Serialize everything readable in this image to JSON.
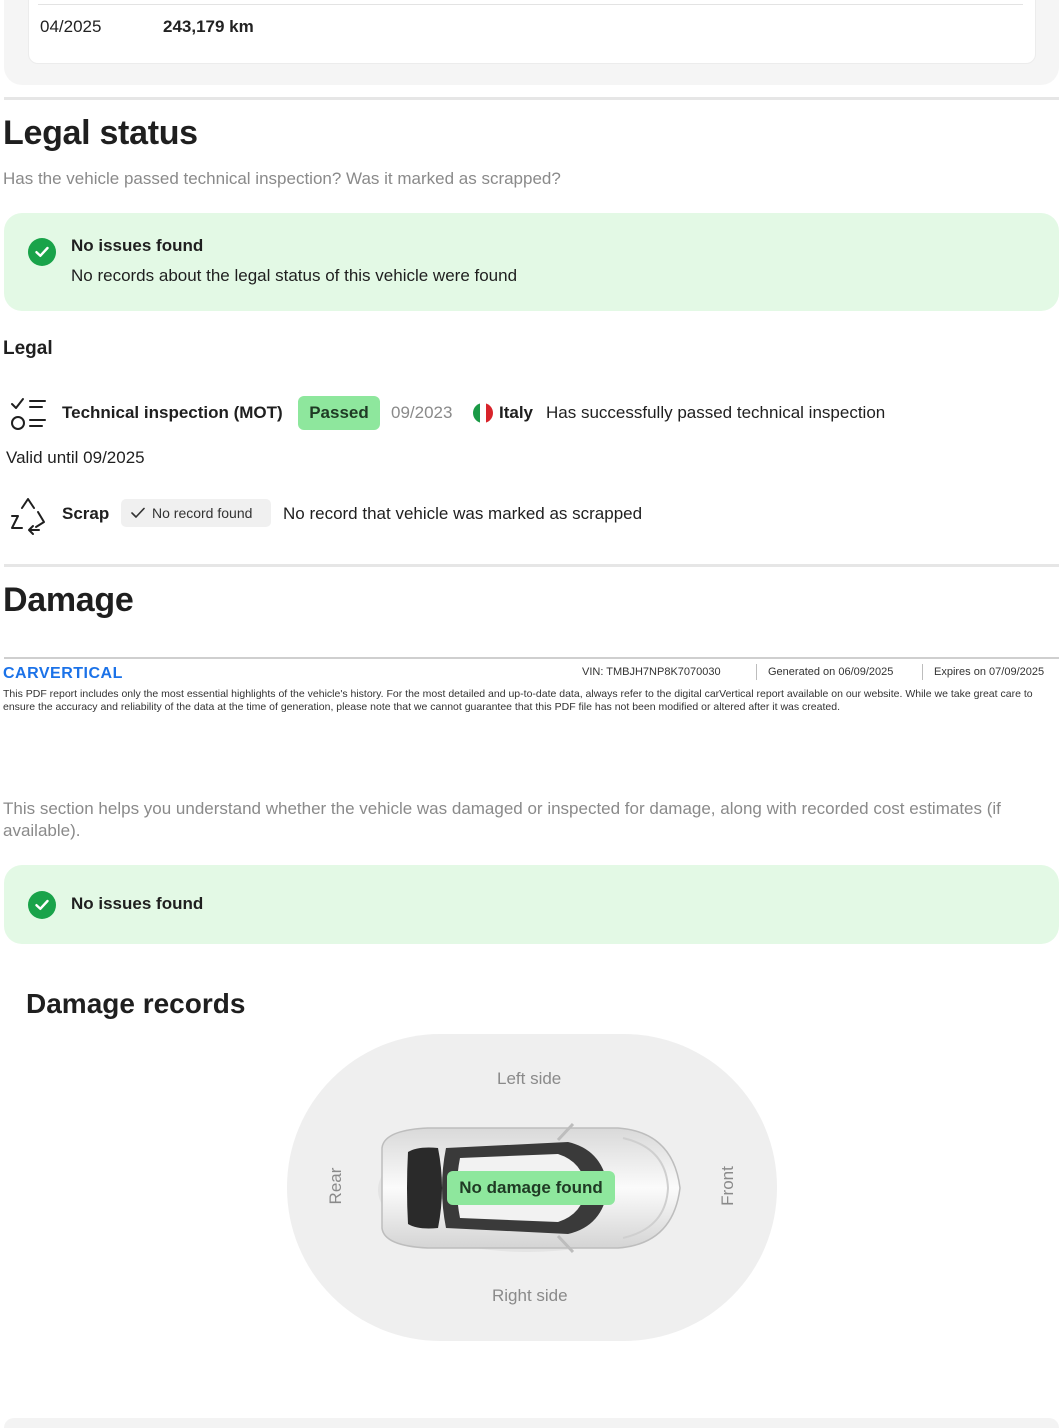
{
  "mileage_row": {
    "date": "04/2025",
    "value": "243,179 km"
  },
  "legal_status": {
    "title": "Legal status",
    "subtitle": "Has the vehicle passed technical inspection? Was it marked as scrapped?",
    "summary": {
      "title": "No issues found",
      "text": "No records about the legal status of this vehicle were found"
    },
    "group_title": "Legal",
    "inspection": {
      "label": "Technical inspection (MOT)",
      "badge": "Passed",
      "date": "09/2023",
      "country": "Italy",
      "description": "Has successfully passed technical inspection",
      "valid_until": "Valid until 09/2025",
      "icon": "checklist-icon"
    },
    "scrap": {
      "label": "Scrap",
      "badge": "No record found",
      "description": "No record that vehicle was marked as scrapped",
      "icon": "recycle-icon"
    }
  },
  "damage": {
    "title": "Damage",
    "subtitle": "This section helps you understand whether the vehicle was damaged or inspected for damage, along with recorded cost estimates (if available).",
    "summary": {
      "title": "No issues found"
    },
    "records_title": "Damage records",
    "diagram": {
      "left_side": "Left side",
      "right_side": "Right side",
      "rear": "Rear",
      "front": "Front",
      "status": "No damage found"
    }
  },
  "pdf_footer": {
    "brand": "CARVERTICAL",
    "vin_label": "VIN:",
    "vin": "TMBJH7NP8K7070030",
    "generated_label": "Generated on",
    "generated": "06/09/2025",
    "expires_label": "Expires on",
    "expires": "07/09/2025",
    "disclaimer": "This PDF report includes only the most essential highlights of the vehicle's history. For the most detailed and up-to-date data, always refer to the digital carVertical report available on our website. While we take great care to ensure the accuracy and reliability of the data at the time of generation, please note that we cannot guarantee that this PDF file has not been modified or altered after it was created."
  },
  "colors": {
    "success": "#19a34a",
    "success_bg": "#e3f9e5",
    "badge_green": "#8ee79d",
    "brand_blue": "#1b72e8",
    "muted_text": "#8a8a8a"
  }
}
